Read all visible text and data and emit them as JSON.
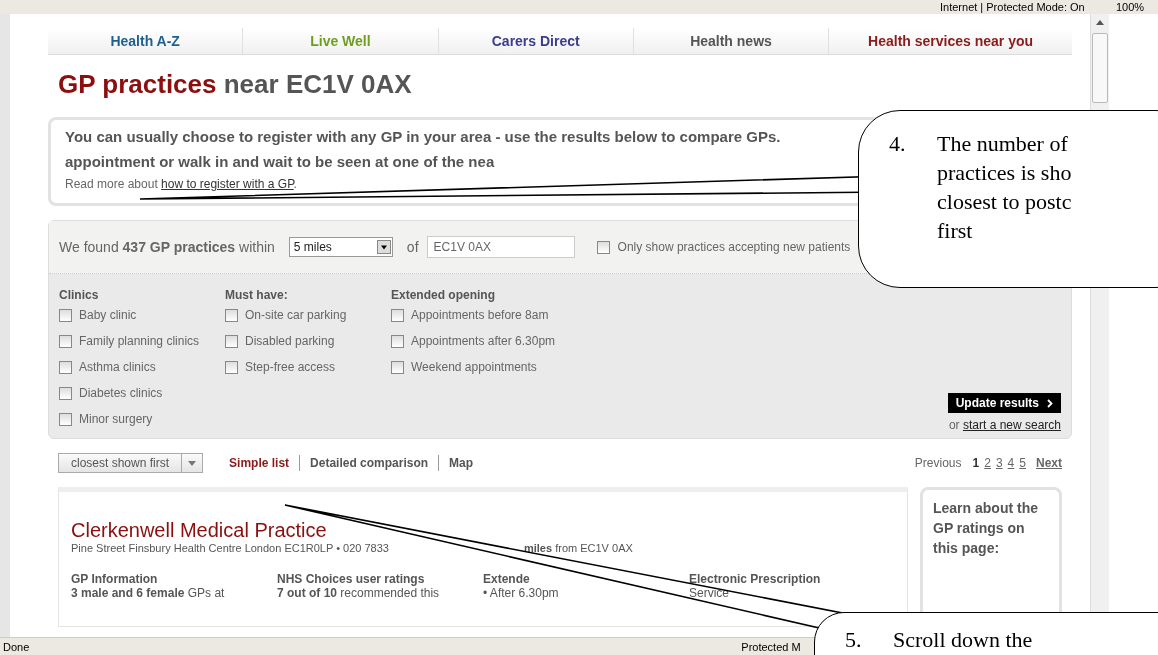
{
  "browser": {
    "zone": "Internet | Protected Mode: On",
    "zoom": "100%",
    "status": "Done",
    "status_zone": "Protected M"
  },
  "nav": [
    {
      "label": "Health A-Z",
      "color": "#1f5f8f"
    },
    {
      "label": "Live Well",
      "color": "#6f9e1f"
    },
    {
      "label": "Carers Direct",
      "color": "#3c3c8c"
    },
    {
      "label": "Health news",
      "color": "#555555"
    },
    {
      "label": "Health services near you",
      "color": "#8b1a1a"
    }
  ],
  "heading": {
    "highlight": "GP practices",
    "rest": "near EC1V 0AX"
  },
  "intro": {
    "lines": [
      "You can usually choose to register with any GP in your area - use the results below to compare GPs.",
      "appointment or walk in and wait to be seen at one of the nea"
    ],
    "read_more": "Read more about",
    "link": "how to register with a GP",
    "after": "."
  },
  "search": {
    "found": "We found **437 GP practices** within",
    "distance": "5 miles",
    "of": "of",
    "postcode": "EC1V 0AX",
    "new_patients": {
      "label": "Only show practices accepting new patients",
      "checked": false
    }
  },
  "filters": [
    {
      "title": "Clinics",
      "options": [
        {
          "label": "Baby clinic",
          "checked": false
        },
        {
          "label": "Family planning clinics",
          "checked": false
        },
        {
          "label": "Asthma clinics",
          "checked": false
        },
        {
          "label": "Diabetes clinics",
          "checked": false
        },
        {
          "label": "Minor surgery",
          "checked": false
        }
      ]
    },
    {
      "title": "Must have:",
      "options": [
        {
          "label": "On-site car parking",
          "checked": false
        },
        {
          "label": "Disabled parking",
          "checked": false
        },
        {
          "label": "Step-free access",
          "checked": false
        }
      ]
    },
    {
      "title": "Extended opening",
      "options": [
        {
          "label": "Appointments before 8am",
          "checked": false
        },
        {
          "label": "Appointments after 6.30pm",
          "checked": false
        },
        {
          "label": "Weekend appointments",
          "checked": false
        }
      ]
    }
  ],
  "update_button": "Update results",
  "or": "or",
  "new_search": "start a new search",
  "sort": "closest shown first",
  "views": [
    {
      "label": "Simple list",
      "selected": true
    },
    {
      "label": "Detailed comparison",
      "selected": false
    },
    {
      "label": "Map",
      "selected": false
    }
  ],
  "pagination": {
    "previous": "Previous",
    "pages": [
      {
        "label": "1",
        "selected": true
      },
      {
        "label": "2",
        "selected": false
      },
      {
        "label": "3",
        "selected": false
      },
      {
        "label": "4",
        "selected": false
      },
      {
        "label": "5",
        "selected": false
      }
    ],
    "next": "Next"
  },
  "practice": {
    "name": "Clerkenwell Medical Practice",
    "address": "Pine Street Finsbury Health Centre London EC1R0LP • 020 7833",
    "distance": "**miles** from EC1V 0AX",
    "columns": [
      {
        "heading": "GP Information",
        "line": "**3 male and 6 female** GPs at"
      },
      {
        "heading": "NHS Choices user ratings",
        "line": "**7 out of 10** recommended this"
      },
      {
        "heading": "Extende",
        "line": "•   After 6.30pm"
      },
      {
        "heading": "Electronic Prescription",
        "line": "Service"
      }
    ]
  },
  "ratings_box": {
    "title": "Learn about the GP ratings on this page:"
  },
  "callouts": [
    {
      "number": "4.",
      "lines": [
        "The number of",
        "practices is sho",
        "closest to postc",
        "first"
      ]
    },
    {
      "number": "5.",
      "lines": [
        "Scroll down the"
      ]
    }
  ]
}
